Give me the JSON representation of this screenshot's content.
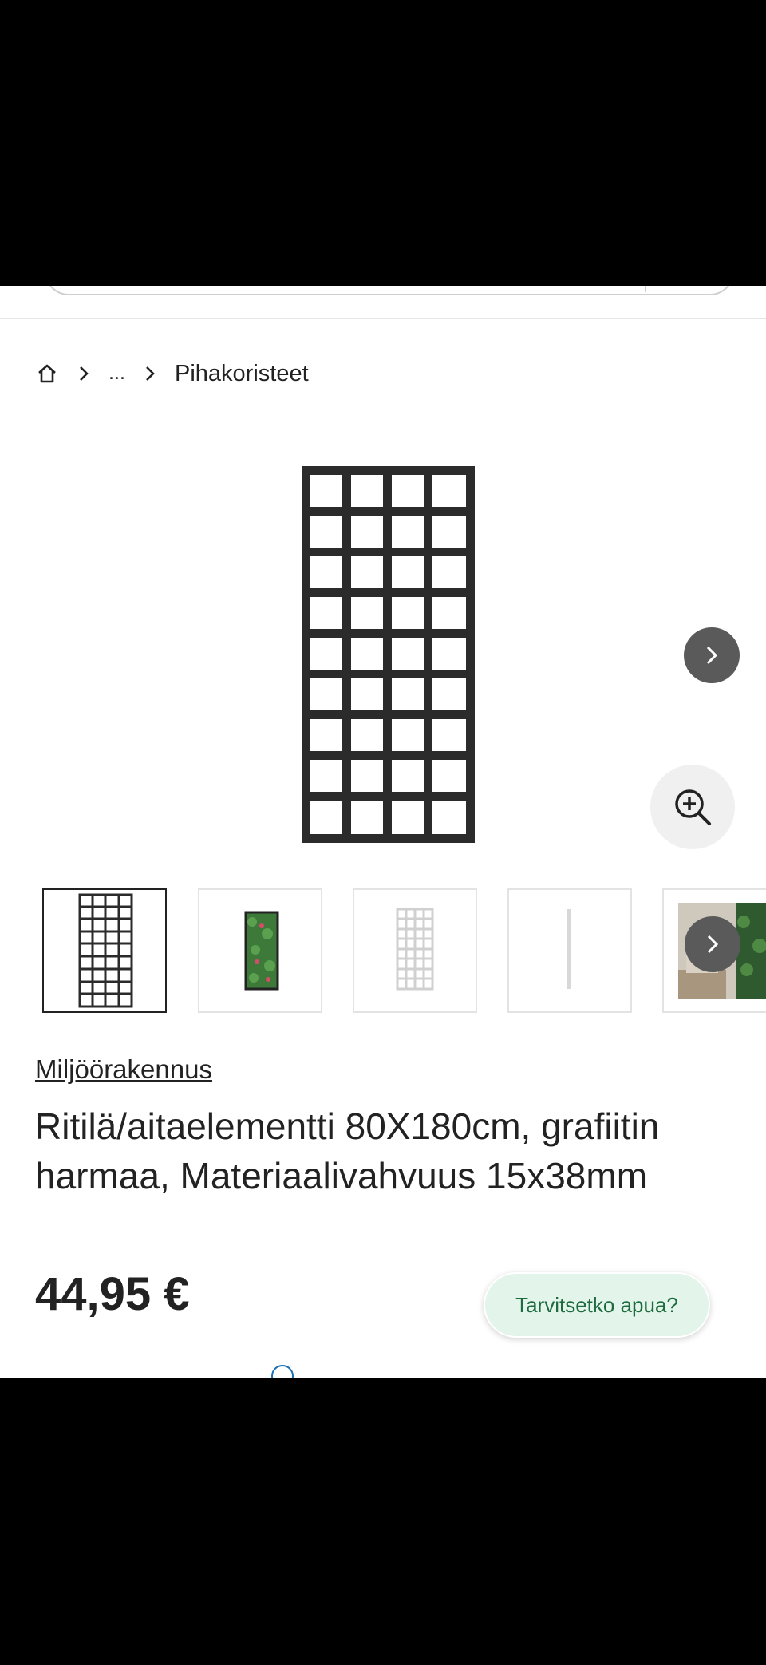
{
  "breadcrumb": {
    "home_icon": "home-icon",
    "ellipsis": "...",
    "current": "Pihakoristeet"
  },
  "gallery": {
    "main_image": "trellis-panel-graphite",
    "thumbnail_count_visible": 5,
    "active_thumbnail": 1
  },
  "product": {
    "brand": "Miljöörakennus",
    "title": "Ritilä/aitaelementti 80X180cm, grafiitin harmaa, Materiaalivahvuus 15x38mm",
    "price": "44,95 €"
  },
  "help": {
    "label": "Tarvitsetko apua?"
  },
  "colors": {
    "trellis": "#2b2b2b",
    "nav_button": "#5a5a5a",
    "help_bg": "#e3f5ea",
    "help_text": "#1d6b3e",
    "link": "#1a6fb5"
  }
}
